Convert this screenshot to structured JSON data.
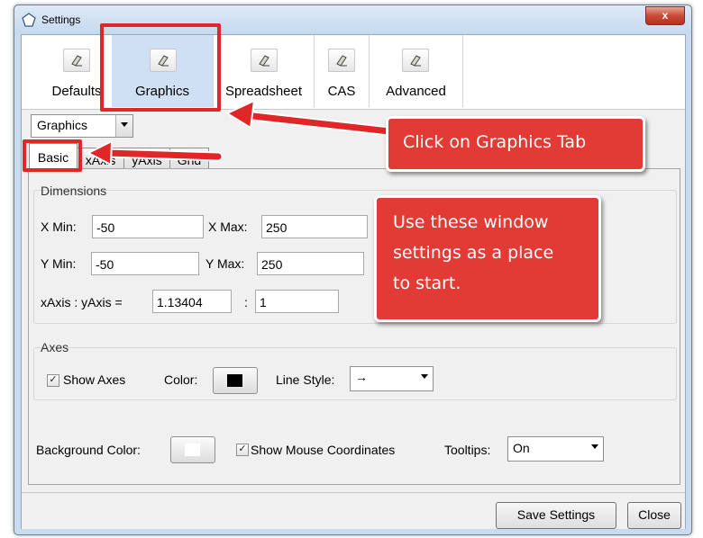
{
  "window": {
    "title": "Settings",
    "close_glyph": "x"
  },
  "tabs": [
    {
      "label": "Defaults",
      "icon": "eraser-icon"
    },
    {
      "label": "Graphics",
      "icon": "eraser-icon"
    },
    {
      "label": "Spreadsheet",
      "icon": "eraser-icon"
    },
    {
      "label": "CAS",
      "icon": "eraser-icon"
    },
    {
      "label": "Advanced",
      "icon": "eraser-icon"
    }
  ],
  "view_selector": {
    "value": "Graphics"
  },
  "subtabs": [
    "Basic",
    "xAxis",
    "yAxis",
    "Grid"
  ],
  "dimensions": {
    "title": "Dimensions",
    "xmin_label": "X Min:",
    "xmin_value": "-50",
    "xmax_label": "X Max:",
    "xmax_value": "250",
    "ymin_label": "Y Min:",
    "ymin_value": "-50",
    "ymax_label": "Y Max:",
    "ymax_value": "250",
    "ratio_label": "xAxis : yAxis =",
    "ratio_x": "1.13404",
    "ratio_sep": ":",
    "ratio_y": "1"
  },
  "axes": {
    "title": "Axes",
    "show_axes_label": "Show Axes",
    "show_axes_checked": true,
    "color_label": "Color:",
    "color_value": "#000000",
    "line_style_label": "Line Style:",
    "line_style_value": "→"
  },
  "misc": {
    "background_color_label": "Background Color:",
    "background_color_value": "#ffffff",
    "show_mouse_coords_label": "Show Mouse Coordinates",
    "show_mouse_coords_checked": true,
    "tooltips_label": "Tooltips:",
    "tooltips_value": "On"
  },
  "buttons": {
    "save": "Save Settings",
    "close": "Close"
  },
  "annotations": {
    "graphics_tab": "Click on Graphics Tab",
    "window_line1": "Use these window",
    "window_line2": "settings as a place",
    "window_line3": "to start."
  },
  "colors": {
    "annotation": "#e23b35",
    "highlight": "#e02626",
    "selected_tab": "#cfe0f4"
  }
}
